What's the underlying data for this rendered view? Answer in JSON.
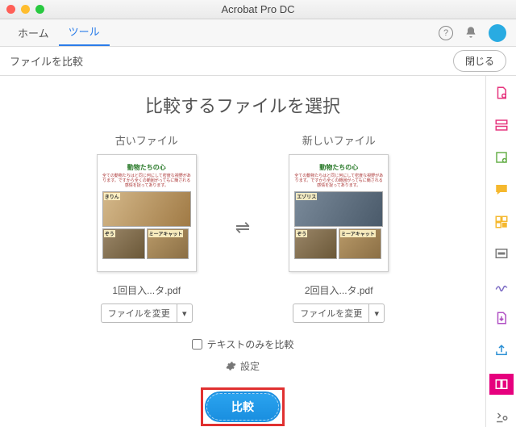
{
  "window": {
    "title": "Acrobat Pro DC"
  },
  "tabs": {
    "home": "ホーム",
    "tools": "ツール"
  },
  "toolbar": {
    "title": "ファイルを比較",
    "close": "閉じる"
  },
  "page": {
    "heading": "比較するファイルを選択",
    "old_label": "古いファイル",
    "new_label": "新しいファイル",
    "old_filename": "1回目入...タ.pdf",
    "new_filename": "2回目入...タ.pdf",
    "change_file": "ファイルを変更",
    "dropdown_arrow": "▾",
    "swap_arrows": "⇌",
    "text_only": "テキストのみを比較",
    "settings": "設定",
    "compare": "比較"
  },
  "doc": {
    "title": "動物たちの心",
    "blurb": "全ての動物たちはと同じ何にして密度な視野があります。ですから全くの範囲がってもに簡される感情を捉ってあります。",
    "old": {
      "img1": "きりん",
      "img2": "ぞう",
      "img3": "ミーアキャット"
    },
    "new": {
      "img1": "エゾリス",
      "img2": "ぞう",
      "img3": "ミーアキャット"
    }
  }
}
